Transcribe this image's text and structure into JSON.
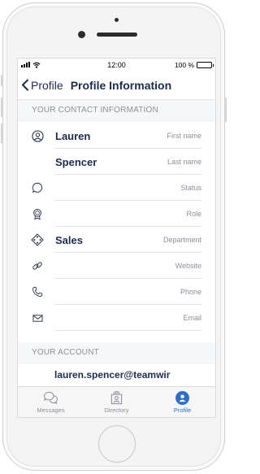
{
  "status_bar": {
    "time": "12:00",
    "battery": "100 %",
    "battery_level": 1.0
  },
  "header": {
    "back_label": "Profile",
    "title": "Profile Information"
  },
  "contact_section": {
    "title": "YOUR CONTACT INFORMATION",
    "fields": [
      {
        "icon": "person-icon",
        "value": "Lauren",
        "label": "First name"
      },
      {
        "icon": "",
        "value": "Spencer",
        "label": "Last name"
      },
      {
        "icon": "speech-bubble-icon",
        "value": "",
        "label": "Status"
      },
      {
        "icon": "badge-icon",
        "value": "",
        "label": "Role"
      },
      {
        "icon": "department-icon",
        "value": "Sales",
        "label": "Department"
      },
      {
        "icon": "link-icon",
        "value": "",
        "label": "Website"
      },
      {
        "icon": "phone-icon",
        "value": "",
        "label": "Phone"
      },
      {
        "icon": "envelope-icon",
        "value": "",
        "label": "Email"
      }
    ]
  },
  "account_section": {
    "title": "YOUR ACCOUNT",
    "username": "lauren.spencer@teamwir"
  },
  "tabs": [
    {
      "label": "Messages",
      "icon": "messages-icon",
      "active": false
    },
    {
      "label": "Directory",
      "icon": "directory-icon",
      "active": false
    },
    {
      "label": "Profile",
      "icon": "profile-icon",
      "active": true
    }
  ],
  "colors": {
    "primary_text": "#1d2b4f",
    "accent": "#2e6ec7",
    "secondary_text": "#8c8f99"
  }
}
